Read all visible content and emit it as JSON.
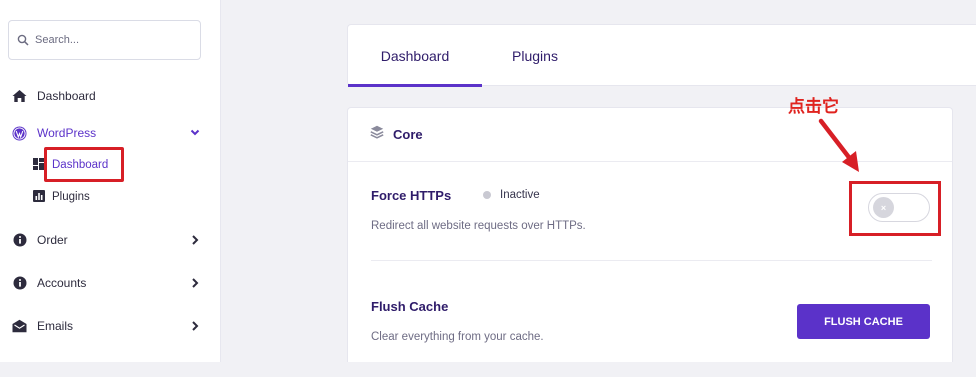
{
  "sidebar": {
    "search_placeholder": "Search...",
    "items": [
      {
        "label": "Dashboard",
        "icon": "home-icon"
      },
      {
        "label": "WordPress",
        "icon": "wordpress-icon"
      },
      {
        "label": "Order",
        "icon": "info-icon"
      },
      {
        "label": "Accounts",
        "icon": "info-icon"
      },
      {
        "label": "Emails",
        "icon": "envelope-icon"
      }
    ],
    "subitems": [
      {
        "label": "Dashboard",
        "icon": "dashboard-grid-icon"
      },
      {
        "label": "Plugins",
        "icon": "chart-icon"
      }
    ]
  },
  "tabs": [
    {
      "label": "Dashboard",
      "active": true
    },
    {
      "label": "Plugins",
      "active": false
    }
  ],
  "panel": {
    "title": "Core",
    "force_https": {
      "title": "Force HTTPs",
      "status": "Inactive",
      "description": "Redirect all website requests over HTTPs.",
      "toggle_state": "off",
      "knob_glyph": "×"
    },
    "flush_cache": {
      "title": "Flush Cache",
      "description": "Clear everything from your cache.",
      "button_label": "FLUSH CACHE"
    }
  },
  "annotation": {
    "text": "点击它"
  },
  "colors": {
    "accent": "#5b32c9",
    "annotation_red": "#d71f26",
    "text_dark": "#2f1c6a"
  }
}
